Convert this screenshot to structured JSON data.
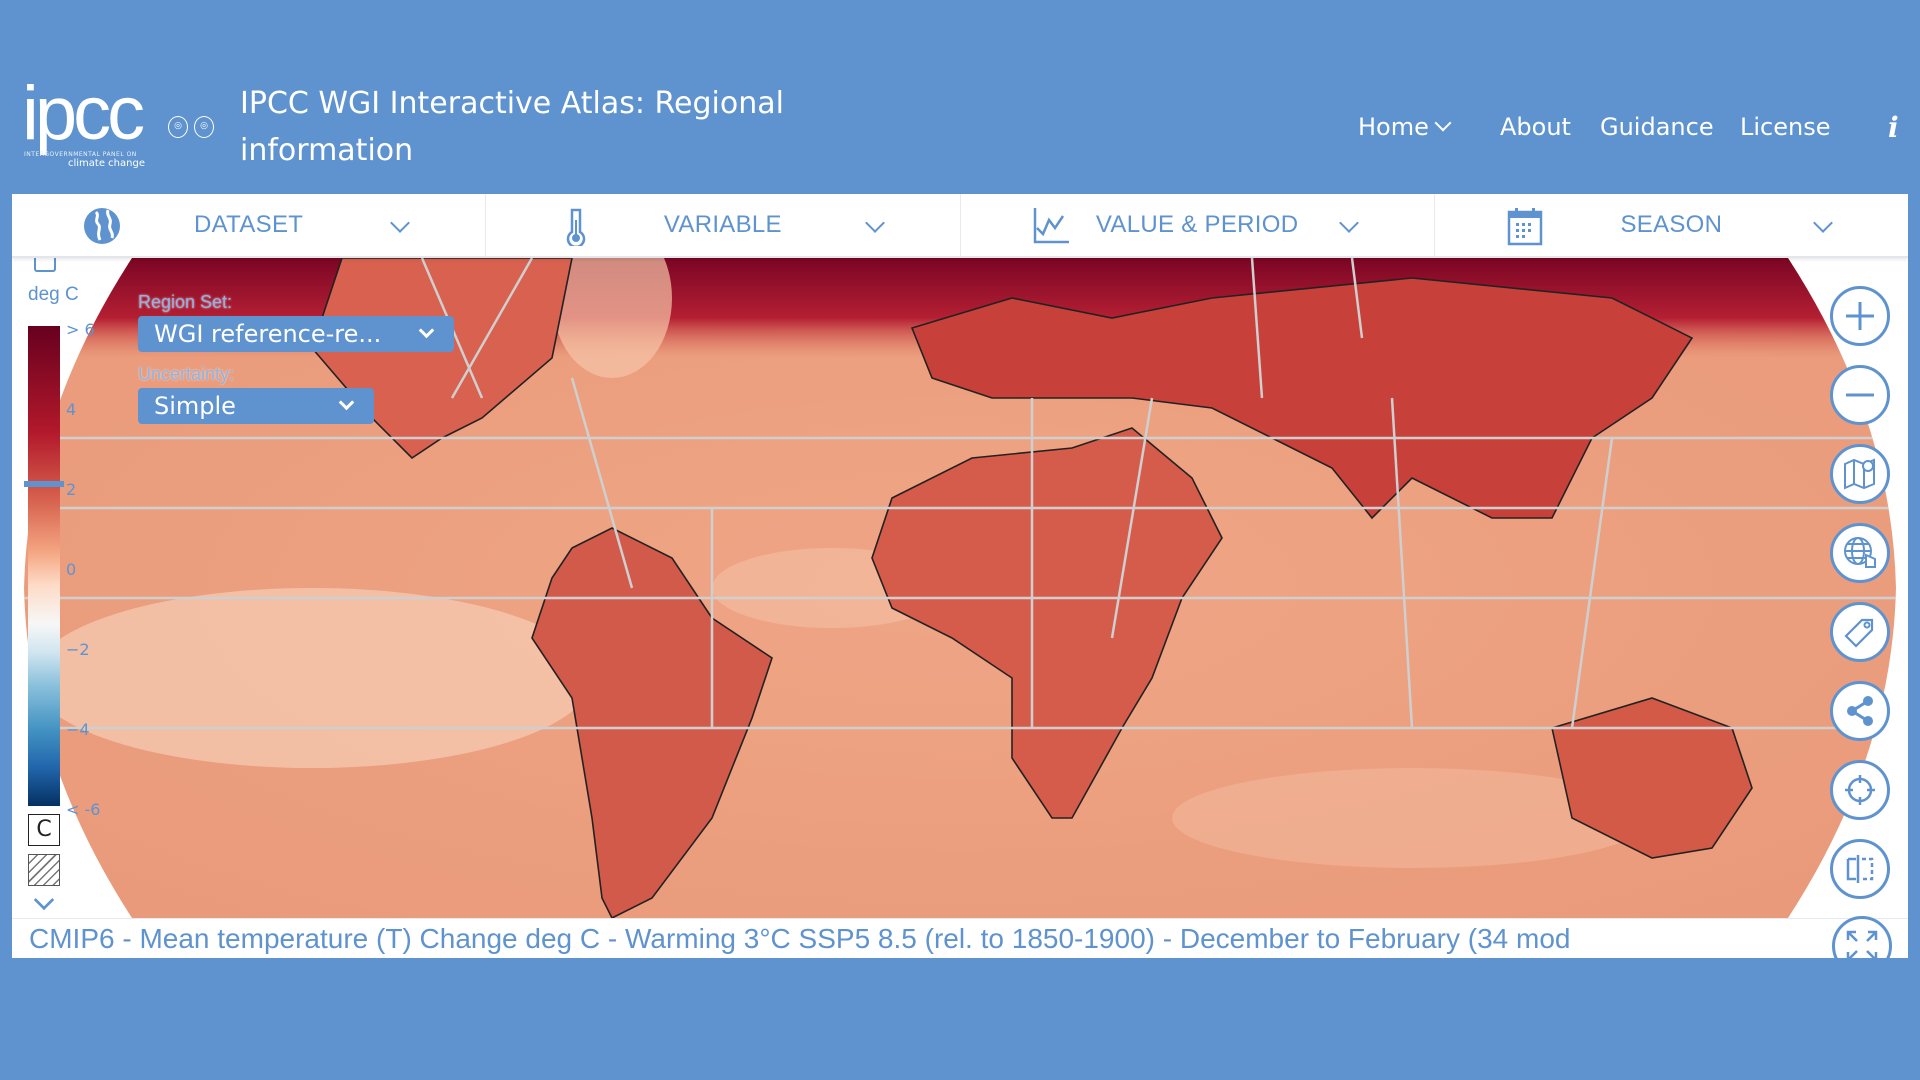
{
  "header": {
    "logo_text": "ipcc",
    "logo_subtitle_line1": "INTERGOVERNMENTAL PANEL ON",
    "logo_subtitle_line2": "climate change",
    "partner_logos": [
      "WMO",
      "UNEP"
    ],
    "title": "IPCC WGI Interactive Atlas: Regional information",
    "nav": [
      {
        "label": "Home",
        "has_dropdown": true
      },
      {
        "label": "About"
      },
      {
        "label": "Guidance"
      },
      {
        "label": "License"
      }
    ],
    "info_icon": "i"
  },
  "toolbar": [
    {
      "label": "DATASET",
      "icon": "globe-icon"
    },
    {
      "label": "VARIABLE",
      "icon": "thermometer-icon"
    },
    {
      "label": "VALUE & PERIOD",
      "icon": "line-chart-icon"
    },
    {
      "label": "SEASON",
      "icon": "calendar-icon"
    }
  ],
  "legend": {
    "unit": "deg C",
    "ticks": [
      "> 6",
      "4",
      "2",
      "0",
      "−2",
      "−4",
      "< -6"
    ],
    "selected_value": 2,
    "range": [
      -6,
      6
    ],
    "consensus_label": "C",
    "colors": [
      "#67001f",
      "#b2182b",
      "#d6604d",
      "#f4a582",
      "#fddbc7",
      "#f7f7f7",
      "#d1e5f0",
      "#92c5de",
      "#4393c3",
      "#2166ac",
      "#053061"
    ]
  },
  "controls": {
    "region_set_label": "Region Set:",
    "region_set_value": "WGI reference-re...",
    "uncertainty_label": "Uncertainty:",
    "uncertainty_value": "Simple"
  },
  "tools": [
    {
      "name": "zoom-in-button",
      "icon": "plus-icon"
    },
    {
      "name": "zoom-out-button",
      "icon": "minus-icon"
    },
    {
      "name": "map-region-button",
      "icon": "map-pin-icon"
    },
    {
      "name": "globe-select-button",
      "icon": "globe-hand-icon"
    },
    {
      "name": "tag-button",
      "icon": "tag-icon"
    },
    {
      "name": "share-button",
      "icon": "share-icon"
    },
    {
      "name": "locate-button",
      "icon": "crosshair-icon"
    },
    {
      "name": "compare-button",
      "icon": "compare-icon"
    },
    {
      "name": "fullscreen-button",
      "icon": "expand-icon"
    }
  ],
  "caption": "CMIP6 - Mean temperature (T) Change deg C - Warming 3°C SSP5 8.5 (rel. to 1850-1900) - December to February (34 mod",
  "colors": {
    "background": "#5f93cf",
    "accent": "#5f93cf"
  }
}
